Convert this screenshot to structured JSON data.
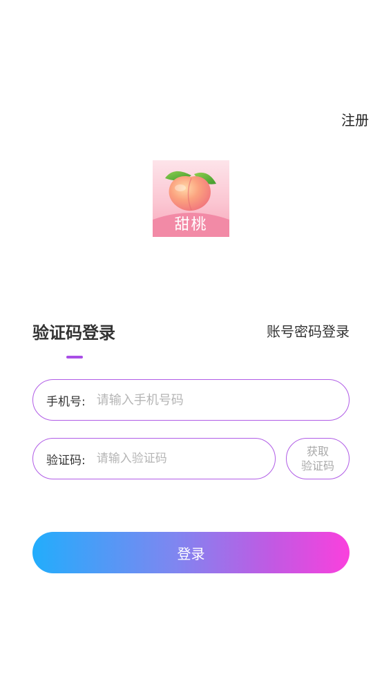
{
  "header": {
    "register_label": "注册"
  },
  "logo": {
    "text": "甜桃",
    "icon": "peach-icon"
  },
  "tabs": {
    "sms_login_label": "验证码登录",
    "password_login_label": "账号密码登录",
    "active": "sms_login"
  },
  "form": {
    "phone": {
      "label": "手机号:",
      "placeholder": "请输入手机号码",
      "value": ""
    },
    "code": {
      "label": "验证码:",
      "placeholder": "请输入验证码",
      "value": ""
    },
    "get_code_line1": "获取",
    "get_code_line2": "验证码",
    "login_label": "登录"
  },
  "colors": {
    "accent": "#a94ee6",
    "login_gradient_start": "#22adfc",
    "login_gradient_end": "#fa40dd"
  }
}
